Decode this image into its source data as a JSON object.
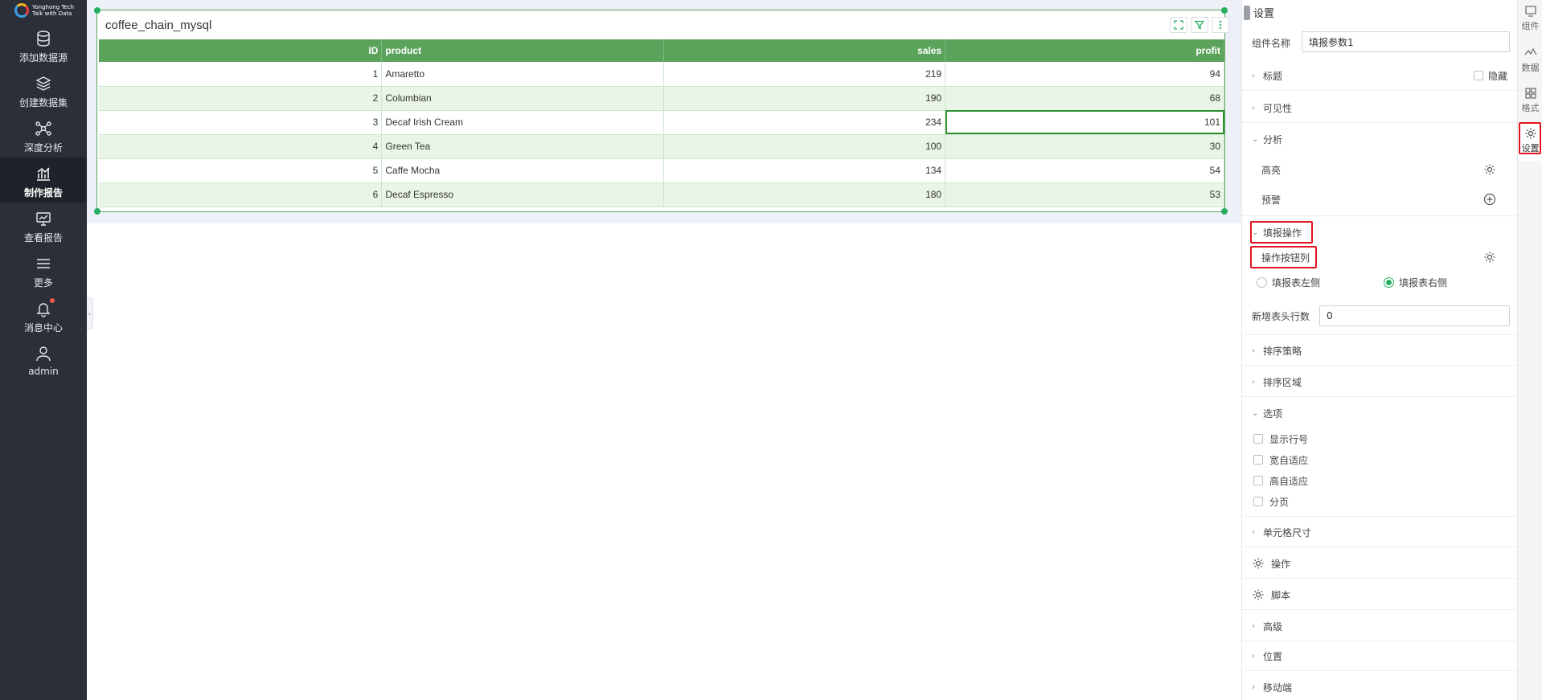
{
  "brand": {
    "name": "Yonghong Tech",
    "slogan": "Talk with Data"
  },
  "nav": [
    {
      "label": "添加数据源",
      "icon": "database-icon"
    },
    {
      "label": "创建数据集",
      "icon": "layers-icon"
    },
    {
      "label": "深度分析",
      "icon": "network-icon"
    },
    {
      "label": "制作报告",
      "icon": "chart-icon",
      "active": true
    },
    {
      "label": "查看报告",
      "icon": "monitor-icon"
    },
    {
      "label": "更多",
      "icon": "menu-icon"
    },
    {
      "label": "消息中心",
      "icon": "bell-icon"
    },
    {
      "label": "admin",
      "icon": "user-icon"
    }
  ],
  "widget": {
    "title": "coffee_chain_mysql",
    "columns": [
      "ID",
      "product",
      "sales",
      "profit"
    ],
    "rows": [
      [
        "1",
        "Amaretto",
        "219",
        "94"
      ],
      [
        "2",
        "Columbian",
        "190",
        "68"
      ],
      [
        "3",
        "Decaf Irish Cream",
        "234",
        "101"
      ],
      [
        "4",
        "Green Tea",
        "100",
        "30"
      ],
      [
        "5",
        "Caffe Mocha",
        "134",
        "54"
      ],
      [
        "6",
        "Decaf Espresso",
        "180",
        "53"
      ]
    ]
  },
  "panel": {
    "header": "设置",
    "component_name_label": "组件名称",
    "component_name_value": "填报参数1",
    "title_section": "标题",
    "hide_label": "隐藏",
    "visibility_section": "可见性",
    "analysis_section": "分析",
    "highlight_label": "高亮",
    "warning_label": "预警",
    "fill_section": "填报操作",
    "op_button_col_label": "操作按钮列",
    "radio_left": "填报表左侧",
    "radio_right": "填报表右侧",
    "new_header_rows_label": "新增表头行数",
    "new_header_rows_value": "0",
    "sort_strategy": "排序策略",
    "sort_area": "排序区域",
    "options_section": "选项",
    "opt_show_row_no": "显示行号",
    "opt_width_fit": "宽自适应",
    "opt_height_fit": "高自适应",
    "opt_paging": "分页",
    "cell_size": "单元格尺寸",
    "operation": "操作",
    "script": "脚本",
    "advanced": "高级",
    "position": "位置",
    "mobile": "移动端"
  },
  "tabs": [
    {
      "label": "组件",
      "icon": "component-icon"
    },
    {
      "label": "数据",
      "icon": "data-icon"
    },
    {
      "label": "格式",
      "icon": "format-icon"
    },
    {
      "label": "设置",
      "icon": "gear-icon",
      "active": true
    }
  ]
}
